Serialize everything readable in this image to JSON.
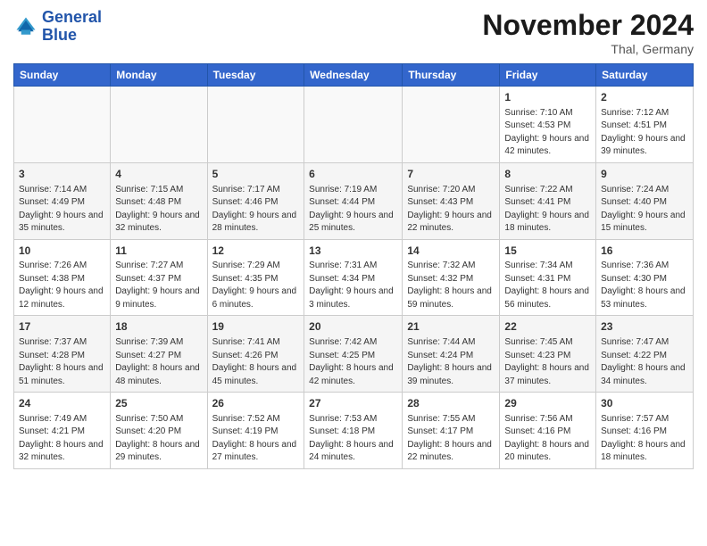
{
  "header": {
    "logo_line1": "General",
    "logo_line2": "Blue",
    "title": "November 2024",
    "subtitle": "Thal, Germany"
  },
  "weekdays": [
    "Sunday",
    "Monday",
    "Tuesday",
    "Wednesday",
    "Thursday",
    "Friday",
    "Saturday"
  ],
  "weeks": [
    [
      {
        "day": "",
        "info": ""
      },
      {
        "day": "",
        "info": ""
      },
      {
        "day": "",
        "info": ""
      },
      {
        "day": "",
        "info": ""
      },
      {
        "day": "",
        "info": ""
      },
      {
        "day": "1",
        "info": "Sunrise: 7:10 AM\nSunset: 4:53 PM\nDaylight: 9 hours\nand 42 minutes."
      },
      {
        "day": "2",
        "info": "Sunrise: 7:12 AM\nSunset: 4:51 PM\nDaylight: 9 hours\nand 39 minutes."
      }
    ],
    [
      {
        "day": "3",
        "info": "Sunrise: 7:14 AM\nSunset: 4:49 PM\nDaylight: 9 hours\nand 35 minutes."
      },
      {
        "day": "4",
        "info": "Sunrise: 7:15 AM\nSunset: 4:48 PM\nDaylight: 9 hours\nand 32 minutes."
      },
      {
        "day": "5",
        "info": "Sunrise: 7:17 AM\nSunset: 4:46 PM\nDaylight: 9 hours\nand 28 minutes."
      },
      {
        "day": "6",
        "info": "Sunrise: 7:19 AM\nSunset: 4:44 PM\nDaylight: 9 hours\nand 25 minutes."
      },
      {
        "day": "7",
        "info": "Sunrise: 7:20 AM\nSunset: 4:43 PM\nDaylight: 9 hours\nand 22 minutes."
      },
      {
        "day": "8",
        "info": "Sunrise: 7:22 AM\nSunset: 4:41 PM\nDaylight: 9 hours\nand 18 minutes."
      },
      {
        "day": "9",
        "info": "Sunrise: 7:24 AM\nSunset: 4:40 PM\nDaylight: 9 hours\nand 15 minutes."
      }
    ],
    [
      {
        "day": "10",
        "info": "Sunrise: 7:26 AM\nSunset: 4:38 PM\nDaylight: 9 hours\nand 12 minutes."
      },
      {
        "day": "11",
        "info": "Sunrise: 7:27 AM\nSunset: 4:37 PM\nDaylight: 9 hours\nand 9 minutes."
      },
      {
        "day": "12",
        "info": "Sunrise: 7:29 AM\nSunset: 4:35 PM\nDaylight: 9 hours\nand 6 minutes."
      },
      {
        "day": "13",
        "info": "Sunrise: 7:31 AM\nSunset: 4:34 PM\nDaylight: 9 hours\nand 3 minutes."
      },
      {
        "day": "14",
        "info": "Sunrise: 7:32 AM\nSunset: 4:32 PM\nDaylight: 8 hours\nand 59 minutes."
      },
      {
        "day": "15",
        "info": "Sunrise: 7:34 AM\nSunset: 4:31 PM\nDaylight: 8 hours\nand 56 minutes."
      },
      {
        "day": "16",
        "info": "Sunrise: 7:36 AM\nSunset: 4:30 PM\nDaylight: 8 hours\nand 53 minutes."
      }
    ],
    [
      {
        "day": "17",
        "info": "Sunrise: 7:37 AM\nSunset: 4:28 PM\nDaylight: 8 hours\nand 51 minutes."
      },
      {
        "day": "18",
        "info": "Sunrise: 7:39 AM\nSunset: 4:27 PM\nDaylight: 8 hours\nand 48 minutes."
      },
      {
        "day": "19",
        "info": "Sunrise: 7:41 AM\nSunset: 4:26 PM\nDaylight: 8 hours\nand 45 minutes."
      },
      {
        "day": "20",
        "info": "Sunrise: 7:42 AM\nSunset: 4:25 PM\nDaylight: 8 hours\nand 42 minutes."
      },
      {
        "day": "21",
        "info": "Sunrise: 7:44 AM\nSunset: 4:24 PM\nDaylight: 8 hours\nand 39 minutes."
      },
      {
        "day": "22",
        "info": "Sunrise: 7:45 AM\nSunset: 4:23 PM\nDaylight: 8 hours\nand 37 minutes."
      },
      {
        "day": "23",
        "info": "Sunrise: 7:47 AM\nSunset: 4:22 PM\nDaylight: 8 hours\nand 34 minutes."
      }
    ],
    [
      {
        "day": "24",
        "info": "Sunrise: 7:49 AM\nSunset: 4:21 PM\nDaylight: 8 hours\nand 32 minutes."
      },
      {
        "day": "25",
        "info": "Sunrise: 7:50 AM\nSunset: 4:20 PM\nDaylight: 8 hours\nand 29 minutes."
      },
      {
        "day": "26",
        "info": "Sunrise: 7:52 AM\nSunset: 4:19 PM\nDaylight: 8 hours\nand 27 minutes."
      },
      {
        "day": "27",
        "info": "Sunrise: 7:53 AM\nSunset: 4:18 PM\nDaylight: 8 hours\nand 24 minutes."
      },
      {
        "day": "28",
        "info": "Sunrise: 7:55 AM\nSunset: 4:17 PM\nDaylight: 8 hours\nand 22 minutes."
      },
      {
        "day": "29",
        "info": "Sunrise: 7:56 AM\nSunset: 4:16 PM\nDaylight: 8 hours\nand 20 minutes."
      },
      {
        "day": "30",
        "info": "Sunrise: 7:57 AM\nSunset: 4:16 PM\nDaylight: 8 hours\nand 18 minutes."
      }
    ]
  ]
}
